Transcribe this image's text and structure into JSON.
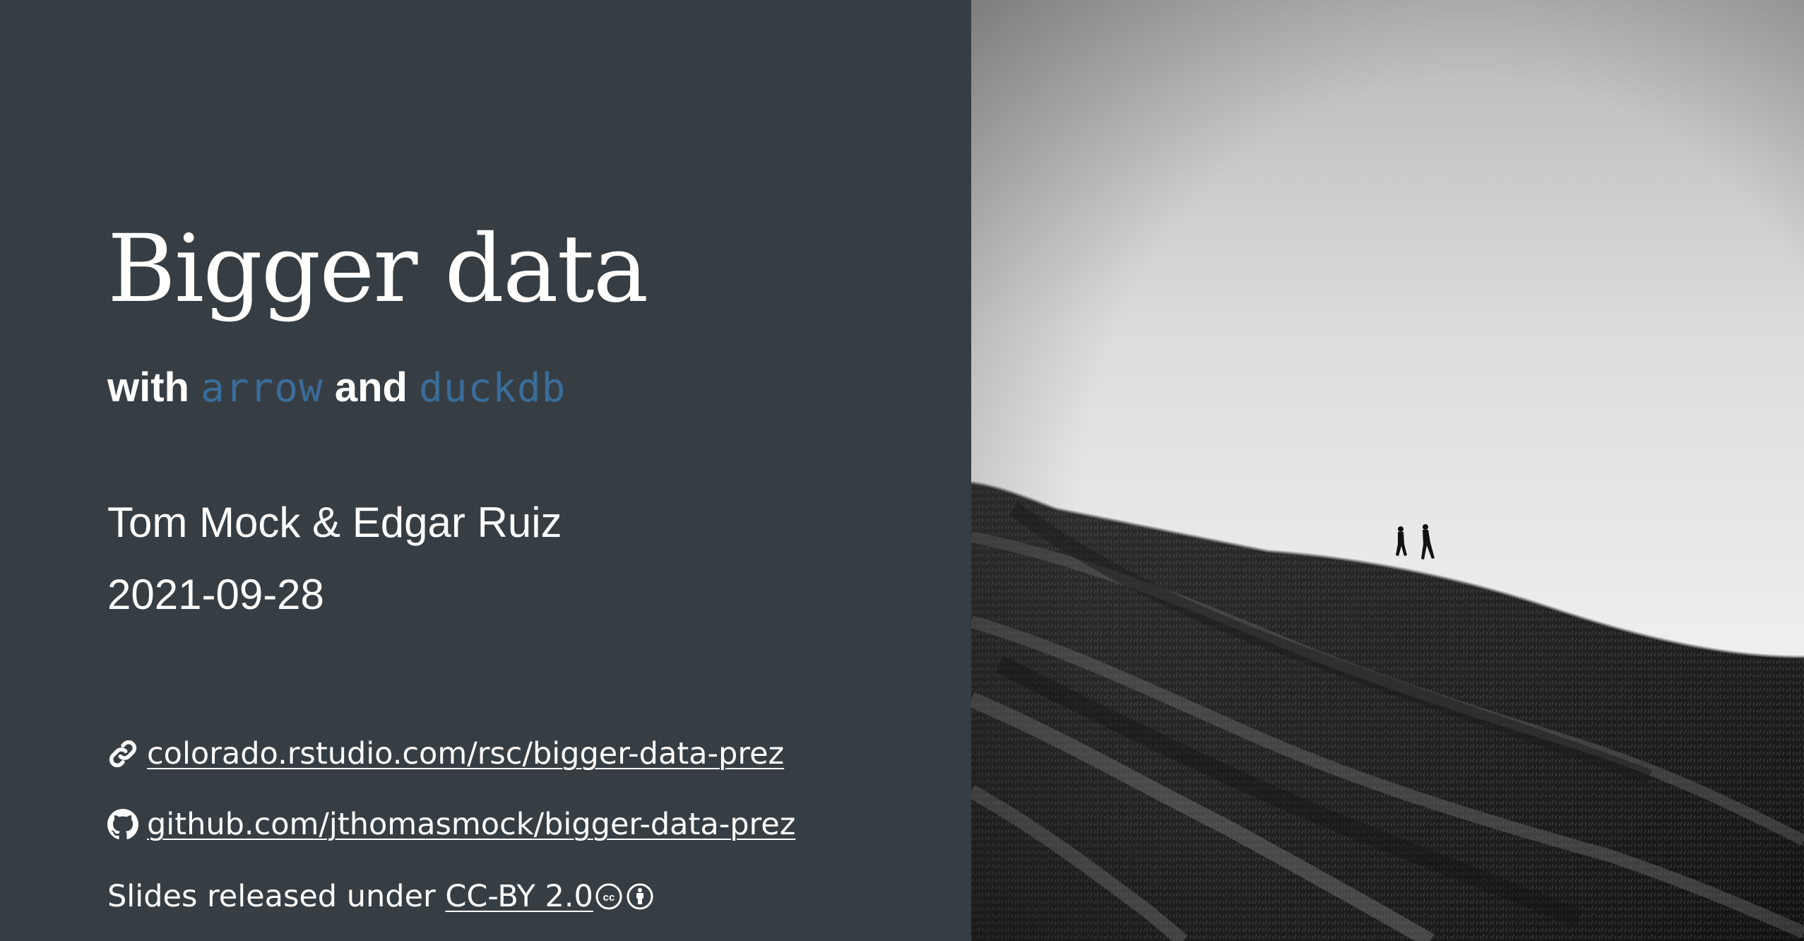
{
  "slide": {
    "title": "Bigger data",
    "subtitle": {
      "with": "with",
      "pkg1": "arrow",
      "and": "and",
      "pkg2": "duckdb"
    },
    "authors": "Tom Mock & Edgar Ruiz",
    "date": "2021-09-28",
    "links": {
      "website": "colorado.rstudio.com/rsc/bigger-data-prez",
      "github": "github.com/jthomasmock/bigger-data-prez"
    },
    "license": {
      "prefix": "Slides released under ",
      "link_text": "CC-BY 2.0"
    },
    "icons": {
      "website": "link-icon",
      "github": "github-icon",
      "license": [
        "cc-icon",
        "attribution-icon"
      ]
    },
    "colors": {
      "background": "#373e43",
      "package_name": "#3a6d9a",
      "text": "#ffffff"
    }
  }
}
